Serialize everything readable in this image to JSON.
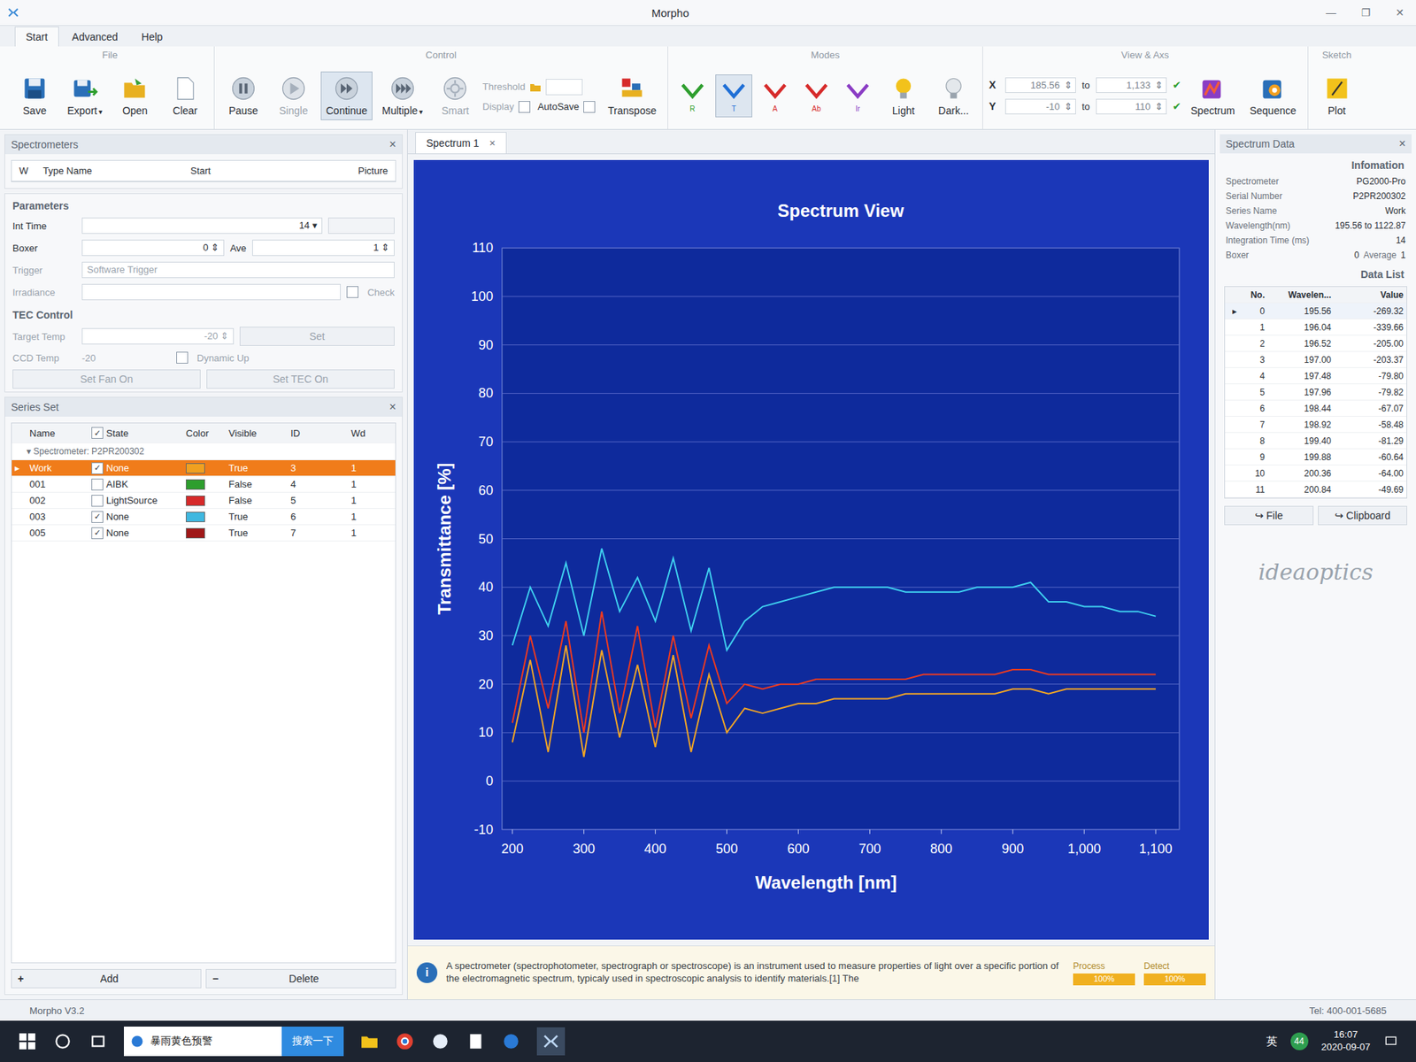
{
  "window": {
    "title": "Morpho",
    "controls": [
      "—",
      "❐",
      "✕"
    ]
  },
  "tabs": [
    {
      "label": "Start",
      "selected": true
    },
    {
      "label": "Advanced",
      "selected": false
    },
    {
      "label": "Help",
      "selected": false
    }
  ],
  "ribbon": {
    "file": {
      "title": "File",
      "buttons": [
        {
          "label": "Save",
          "dropdown": false
        },
        {
          "label": "Export",
          "dropdown": true
        },
        {
          "label": "Open",
          "dropdown": false
        },
        {
          "label": "Clear",
          "dropdown": false
        }
      ]
    },
    "control": {
      "title": "Control",
      "buttons": [
        {
          "label": "Pause",
          "disabled": false,
          "selected": false,
          "dropdown": false
        },
        {
          "label": "Single",
          "disabled": true,
          "selected": false,
          "dropdown": false
        },
        {
          "label": "Continue",
          "disabled": false,
          "selected": true,
          "dropdown": false
        },
        {
          "label": "Multiple",
          "disabled": false,
          "selected": false,
          "dropdown": true
        },
        {
          "label": "Smart",
          "disabled": true,
          "selected": false,
          "dropdown": false
        }
      ],
      "threshold": {
        "label": "Threshold",
        "value": ""
      },
      "display": {
        "label": "Display",
        "checked": false
      },
      "autosave": {
        "label": "AutoSave",
        "checked": false
      },
      "transpose": {
        "label": "Transpose"
      }
    },
    "modes": {
      "title": "Modes",
      "items": [
        {
          "letter": "R",
          "color": "#2e9e2e",
          "selected": false
        },
        {
          "letter": "T",
          "color": "#1f6fd6",
          "selected": true
        },
        {
          "letter": "A",
          "color": "#d62a2a",
          "selected": false
        },
        {
          "letter": "Ab",
          "color": "#d62a2a",
          "selected": false
        },
        {
          "letter": "Ir",
          "color": "#8a3cc4",
          "selected": false
        }
      ]
    },
    "light": {
      "label": "Light"
    },
    "dark": {
      "label": "Dark..."
    },
    "view": {
      "title": "View & Axs",
      "connector": "to",
      "x": {
        "label": "X",
        "from": "185.56",
        "to": "1,133"
      },
      "y": {
        "label": "Y",
        "from": "-10",
        "to": "110"
      }
    },
    "spectrum": {
      "label": "Spectrum"
    },
    "sequence": {
      "label": "Sequence"
    },
    "sketch": {
      "title": "Sketch",
      "label": "Plot"
    }
  },
  "panel_close": "×",
  "spectrometers": {
    "title": "Spectrometers",
    "columns": [
      "W",
      "Type Name",
      "Start",
      "Picture"
    ]
  },
  "parameters": {
    "title": "Parameters",
    "int_time": {
      "label": "Int Time",
      "value": "14"
    },
    "boxer": {
      "label": "Boxer",
      "value": "0"
    },
    "ave": {
      "label": "Ave",
      "value": "1"
    },
    "trigger": {
      "label": "Trigger",
      "value": "Software Trigger"
    },
    "irradiance": {
      "label": "Irradiance",
      "value": ""
    },
    "check": {
      "label": "Check",
      "checked": false
    }
  },
  "tec": {
    "title": "TEC Control",
    "target_temp": {
      "label": "Target Temp",
      "value": "-20"
    },
    "set": "Set",
    "ccd_temp": {
      "label": "CCD Temp",
      "value": "-20"
    },
    "dynamic_up": {
      "label": "Dynamic Up",
      "checked": false
    },
    "fan_button": "Set Fan On",
    "tec_button": "Set TEC On"
  },
  "series_set": {
    "title": "Series Set",
    "columns": [
      "Name",
      "State",
      "Color",
      "Visible",
      "ID",
      "Wd"
    ],
    "header_checked": true,
    "group": "Spectrometer: P2PR200302",
    "rows": [
      {
        "name": "Work",
        "checked": true,
        "state": "None",
        "color": "#f0a020",
        "visible": "True",
        "id": "3",
        "wd": "1",
        "selected": true
      },
      {
        "name": "001",
        "checked": false,
        "state": "AIBK",
        "color": "#2e9e2e",
        "visible": "False",
        "id": "4",
        "wd": "1",
        "selected": false
      },
      {
        "name": "002",
        "checked": false,
        "state": "LightSource",
        "color": "#d62a2a",
        "visible": "False",
        "id": "5",
        "wd": "1",
        "selected": false
      },
      {
        "name": "003",
        "checked": true,
        "state": "None",
        "color": "#3fb8e0",
        "visible": "True",
        "id": "6",
        "wd": "1",
        "selected": false
      },
      {
        "name": "005",
        "checked": true,
        "state": "None",
        "color": "#a01818",
        "visible": "True",
        "id": "7",
        "wd": "1",
        "selected": false
      }
    ],
    "add_icon": "+",
    "add": "Add",
    "delete_icon": "−",
    "delete": "Delete"
  },
  "document_tab": {
    "label": "Spectrum 1",
    "close": "×",
    "selected": true
  },
  "chart": {
    "title": "Spectrum View",
    "y_label": "Transmittance [%]",
    "x_label": "Wavelength [nm]",
    "y_ticks": [
      "110",
      "100",
      "90",
      "80",
      "70",
      "60",
      "50",
      "40",
      "30",
      "20",
      "10",
      "0",
      "-10"
    ],
    "x_ticks": [
      "200",
      "300",
      "400",
      "500",
      "600",
      "700",
      "800",
      "900",
      "1,000",
      "1,100"
    ],
    "x_values": [
      200,
      225,
      250,
      275,
      300,
      325,
      350,
      375,
      400,
      425,
      450,
      475,
      500,
      525,
      550,
      575,
      600,
      625,
      650,
      675,
      700,
      725,
      750,
      775,
      800,
      825,
      850,
      875,
      900,
      925,
      950,
      975,
      1000,
      1025,
      1050,
      1075,
      1100
    ],
    "series": [
      {
        "name": "003",
        "color": "#3fd0f0",
        "values": [
          28,
          40,
          32,
          45,
          30,
          48,
          35,
          42,
          33,
          46,
          31,
          44,
          27,
          33,
          36,
          37,
          38,
          39,
          40,
          40,
          40,
          40,
          39,
          39,
          39,
          39,
          40,
          40,
          40,
          41,
          37,
          37,
          36,
          36,
          35,
          35,
          34
        ]
      },
      {
        "name": "005",
        "color": "#f03a1e",
        "values": [
          12,
          30,
          15,
          33,
          10,
          35,
          14,
          32,
          11,
          30,
          13,
          28,
          16,
          20,
          19,
          20,
          20,
          21,
          21,
          21,
          21,
          21,
          21,
          22,
          22,
          22,
          22,
          22,
          23,
          23,
          22,
          22,
          22,
          22,
          22,
          22,
          22
        ]
      },
      {
        "name": "Work",
        "color": "#f5a623",
        "values": [
          8,
          25,
          6,
          28,
          5,
          27,
          9,
          24,
          7,
          26,
          6,
          22,
          10,
          15,
          14,
          15,
          16,
          16,
          17,
          17,
          17,
          17,
          18,
          18,
          18,
          18,
          18,
          18,
          19,
          19,
          18,
          19,
          19,
          19,
          19,
          19,
          19
        ]
      }
    ]
  },
  "info": {
    "icon": "i",
    "text": "A spectrometer (spectrophotometer, spectrograph or spectroscope) is an instrument used to measure properties of light over a specific portion of the electromagnetic spectrum, typicaly used in spectroscopic analysis to identify materials.[1] The",
    "process": {
      "label": "Process",
      "value": "100%",
      "level": 1
    },
    "detect": {
      "label": "Detect",
      "value": "100%",
      "level": 1
    }
  },
  "spectrum_data": {
    "title": "Spectrum Data",
    "info_title": "Infomation",
    "fields": [
      {
        "label": "Spectrometer",
        "value": "PG2000-Pro"
      },
      {
        "label": "Serial Number",
        "value": "P2PR200302"
      },
      {
        "label": "Series Name",
        "value": "Work"
      },
      {
        "label": "Wavelength(nm)",
        "value": "195.56  to  1122.87"
      },
      {
        "label": "Integration Time (ms)",
        "value": "14"
      },
      {
        "label": "Boxer",
        "value": "0",
        "extra_label": "Average",
        "extra_value": "1"
      }
    ]
  },
  "data_list": {
    "title": "Data List",
    "columns": [
      "No.",
      "Wavelen...",
      "Value"
    ],
    "rows": [
      {
        "no": "0",
        "wavelength": "195.56",
        "value": "-269.32",
        "selected": true
      },
      {
        "no": "1",
        "wavelength": "196.04",
        "value": "-339.66",
        "selected": false
      },
      {
        "no": "2",
        "wavelength": "196.52",
        "value": "-205.00",
        "selected": false
      },
      {
        "no": "3",
        "wavelength": "197.00",
        "value": "-203.37",
        "selected": false
      },
      {
        "no": "4",
        "wavelength": "197.48",
        "value": "-79.80",
        "selected": false
      },
      {
        "no": "5",
        "wavelength": "197.96",
        "value": "-79.82",
        "selected": false
      },
      {
        "no": "6",
        "wavelength": "198.44",
        "value": "-67.07",
        "selected": false
      },
      {
        "no": "7",
        "wavelength": "198.92",
        "value": "-58.48",
        "selected": false
      },
      {
        "no": "8",
        "wavelength": "199.40",
        "value": "-81.29",
        "selected": false
      },
      {
        "no": "9",
        "wavelength": "199.88",
        "value": "-60.64",
        "selected": false
      },
      {
        "no": "10",
        "wavelength": "200.36",
        "value": "-64.00",
        "selected": false
      },
      {
        "no": "11",
        "wavelength": "200.84",
        "value": "-49.69",
        "selected": false
      }
    ],
    "file": "File",
    "clipboard": "Clipboard"
  },
  "logo": "ideaoptics",
  "status": {
    "version": "Morpho V3.2",
    "tel": "Tel: 400-001-5685"
  },
  "taskbar": {
    "search_text": "暴雨黄色预警",
    "search_button": "搜索一下",
    "lang": "英",
    "badge": "44",
    "time": "16:07",
    "date": "2020-09-07"
  }
}
